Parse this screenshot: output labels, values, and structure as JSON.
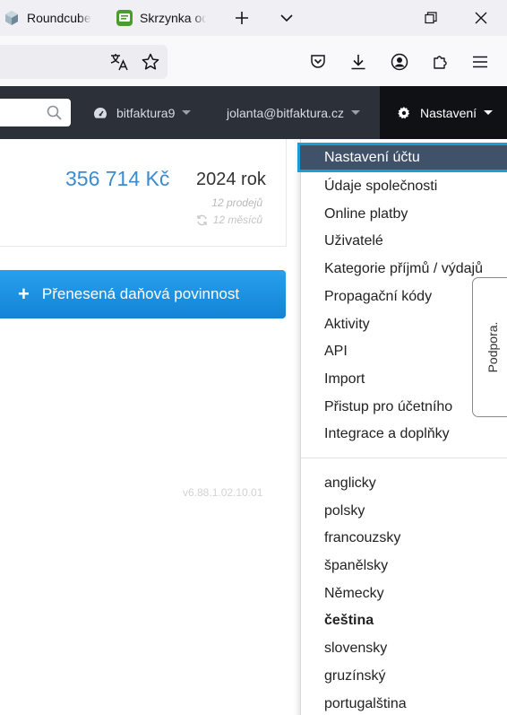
{
  "browser": {
    "tabs": [
      {
        "title": "Roundcube"
      },
      {
        "title": "Skrzynka odbiorcza"
      }
    ]
  },
  "navbar": {
    "company": "bitfaktura9",
    "user": "jolanta@bitfaktura.cz",
    "settings": "Nastavení"
  },
  "stats": {
    "amount": "356 714 Kč",
    "year": "2024 rok",
    "sales": "12 prodejů",
    "months": "12 měsíců"
  },
  "main": {
    "transfer_button": "Přenesená daňová povinnost",
    "version": "v6.88.1.02.10.01"
  },
  "dropdown": {
    "active_item": "Nastavení účtu",
    "items": [
      "Údaje společnosti",
      "Online platby",
      "Uživatelé",
      "Kategorie příjmů / výdajů",
      "Propagační kódy",
      "Aktivity",
      "API",
      "Import",
      "Přistup pro účetního",
      "Integrace a doplňky"
    ],
    "languages": [
      "anglicky",
      "polsky",
      "francouzsky",
      "španělsky",
      "Německy",
      "čeština",
      "slovensky",
      "gruzínský",
      "portugalština"
    ],
    "current_language": "čeština"
  },
  "support": {
    "label": "Podpora."
  },
  "colors": {
    "navbar": "#2c3139",
    "accent": "#1f9ad8",
    "amount": "#3b8bd0",
    "active_item": "#40516a"
  }
}
